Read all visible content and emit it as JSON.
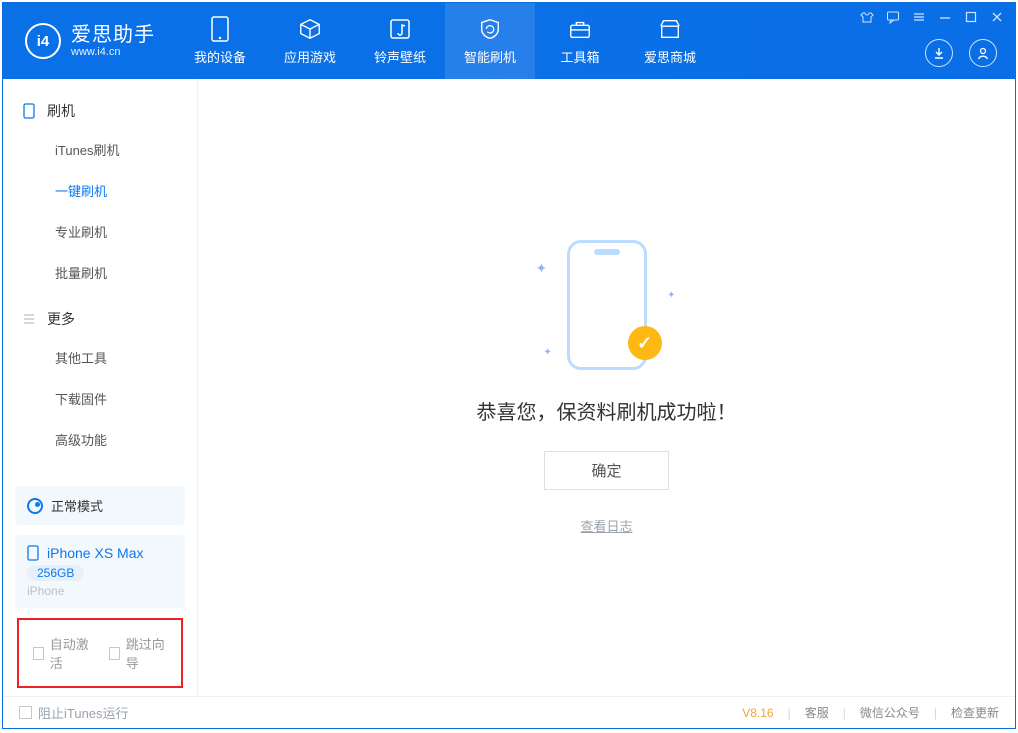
{
  "brand": {
    "title": "爱思助手",
    "subtitle": "www.i4.cn",
    "logo_letter": "i4"
  },
  "tabs": [
    {
      "label": "我的设备",
      "icon": "device-icon"
    },
    {
      "label": "应用游戏",
      "icon": "cube-icon"
    },
    {
      "label": "铃声壁纸",
      "icon": "music-note-icon"
    },
    {
      "label": "智能刷机",
      "icon": "shield-sync-icon",
      "active": true
    },
    {
      "label": "工具箱",
      "icon": "toolbox-icon"
    },
    {
      "label": "爱思商城",
      "icon": "store-icon"
    }
  ],
  "sidebar": {
    "section1": {
      "title": "刷机",
      "items": [
        "iTunes刷机",
        "一键刷机",
        "专业刷机",
        "批量刷机"
      ],
      "active_index": 1
    },
    "section2": {
      "title": "更多",
      "items": [
        "其他工具",
        "下载固件",
        "高级功能"
      ]
    },
    "mode_label": "正常模式",
    "device": {
      "name": "iPhone XS Max",
      "capacity": "256GB",
      "type": "iPhone"
    },
    "options": {
      "auto_activate": "自动激活",
      "skip_guide": "跳过向导"
    }
  },
  "main": {
    "success_message": "恭喜您，保资料刷机成功啦！",
    "ok_button": "确定",
    "view_log": "查看日志"
  },
  "statusbar": {
    "block_itunes": "阻止iTunes运行",
    "version": "V8.16",
    "links": [
      "客服",
      "微信公众号",
      "检查更新"
    ]
  }
}
